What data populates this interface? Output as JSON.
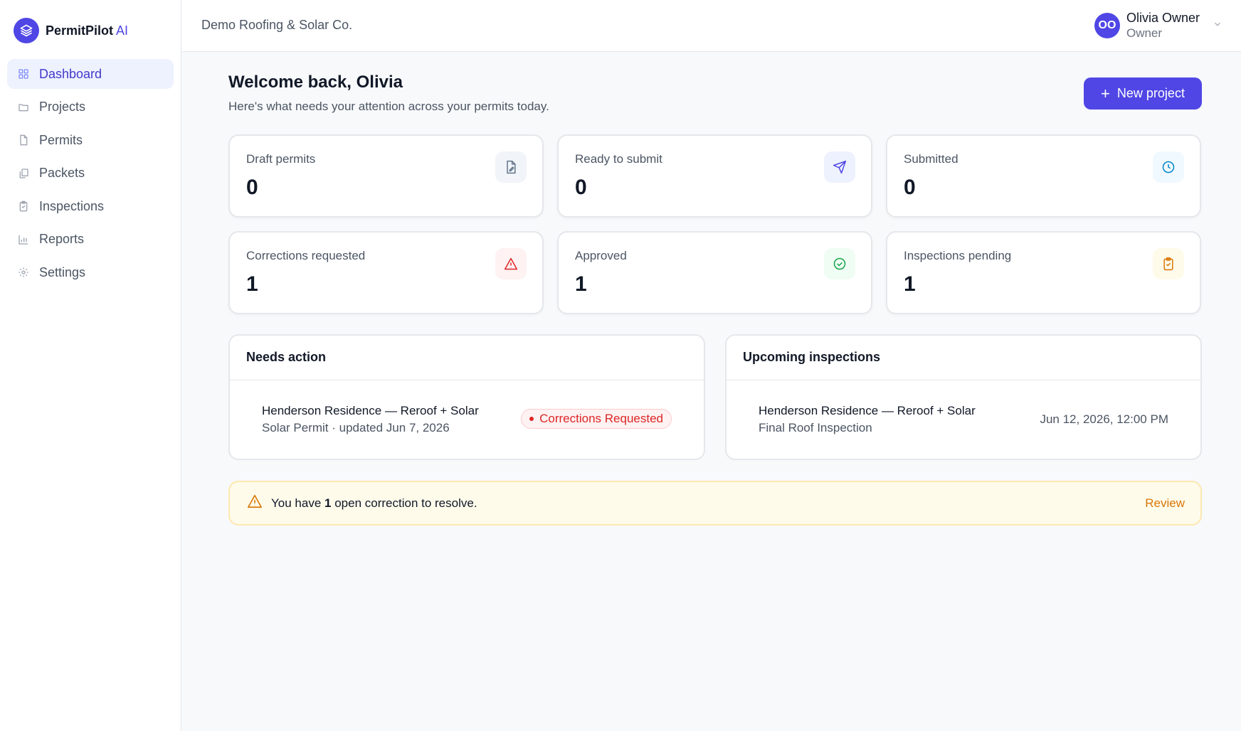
{
  "brand": {
    "name": "PermitPilot",
    "suffix": "AI"
  },
  "sidebar": {
    "items": [
      {
        "label": "Dashboard",
        "icon": "grid-icon",
        "active": true
      },
      {
        "label": "Projects",
        "icon": "folder-icon"
      },
      {
        "label": "Permits",
        "icon": "file-icon"
      },
      {
        "label": "Packets",
        "icon": "copy-icon"
      },
      {
        "label": "Inspections",
        "icon": "clipboard-icon"
      },
      {
        "label": "Reports",
        "icon": "bar-chart-icon"
      },
      {
        "label": "Settings",
        "icon": "gear-icon"
      }
    ]
  },
  "topbar": {
    "org": "Demo Roofing & Solar Co.",
    "user": {
      "initials": "OO",
      "name": "Olivia Owner",
      "role": "Owner"
    }
  },
  "header": {
    "title": "Welcome back, Olivia",
    "subtitle": "Here's what needs your attention across your permits today.",
    "new_button": "New project"
  },
  "stats": [
    {
      "label": "Draft permits",
      "value": "0",
      "icon": "file-edit-icon",
      "color": "#64748b"
    },
    {
      "label": "Ready to submit",
      "value": "0",
      "icon": "send-icon",
      "color": "#4f46e5"
    },
    {
      "label": "Submitted",
      "value": "0",
      "icon": "clock-icon",
      "color": "#0284c7"
    },
    {
      "label": "Corrections requested",
      "value": "1",
      "icon": "alert-triangle-icon",
      "color": "#dc2626"
    },
    {
      "label": "Approved",
      "value": "1",
      "icon": "check-circle-icon",
      "color": "#16a34a"
    },
    {
      "label": "Inspections pending",
      "value": "1",
      "icon": "clipboard-check-icon",
      "color": "#d97706"
    }
  ],
  "needs_action": {
    "title": "Needs action",
    "items": [
      {
        "title": "Henderson Residence — Reroof + Solar",
        "subtitle": "Solar Permit · updated Jun 7, 2026",
        "status": "Corrections Requested"
      }
    ]
  },
  "upcoming": {
    "title": "Upcoming inspections",
    "items": [
      {
        "title": "Henderson Residence — Reroof + Solar",
        "subtitle": "Final Roof Inspection",
        "datetime": "Jun 12, 2026, 12:00 PM"
      }
    ]
  },
  "alert": {
    "prefix": "You have",
    "count": "1",
    "suffix": "open correction to resolve.",
    "action": "Review"
  }
}
